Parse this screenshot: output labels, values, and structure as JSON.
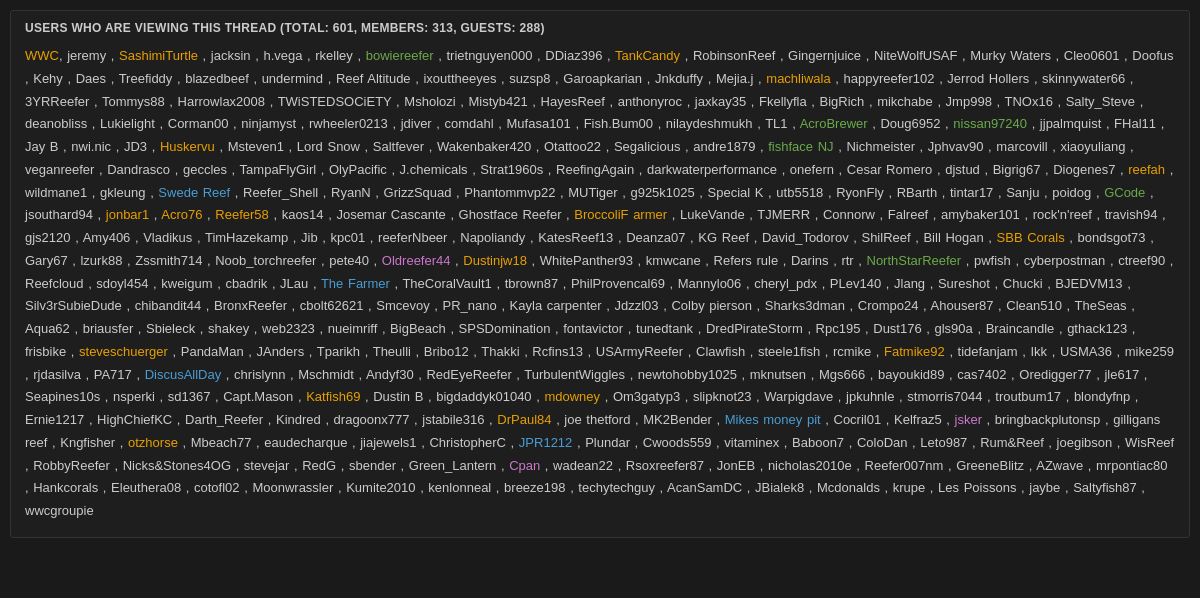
{
  "header": {
    "title": "USERS WHO ARE VIEWING THIS THREAD (TOTAL: 601, MEMBERS: 313, GUESTS: 288)"
  },
  "colors": {
    "background": "#1e1e1e",
    "border": "#333333",
    "text": "#cccccc",
    "orange": "#e8a000",
    "green": "#6aaa4b",
    "blue": "#4a9dd4",
    "pink": "#cc77cc"
  }
}
